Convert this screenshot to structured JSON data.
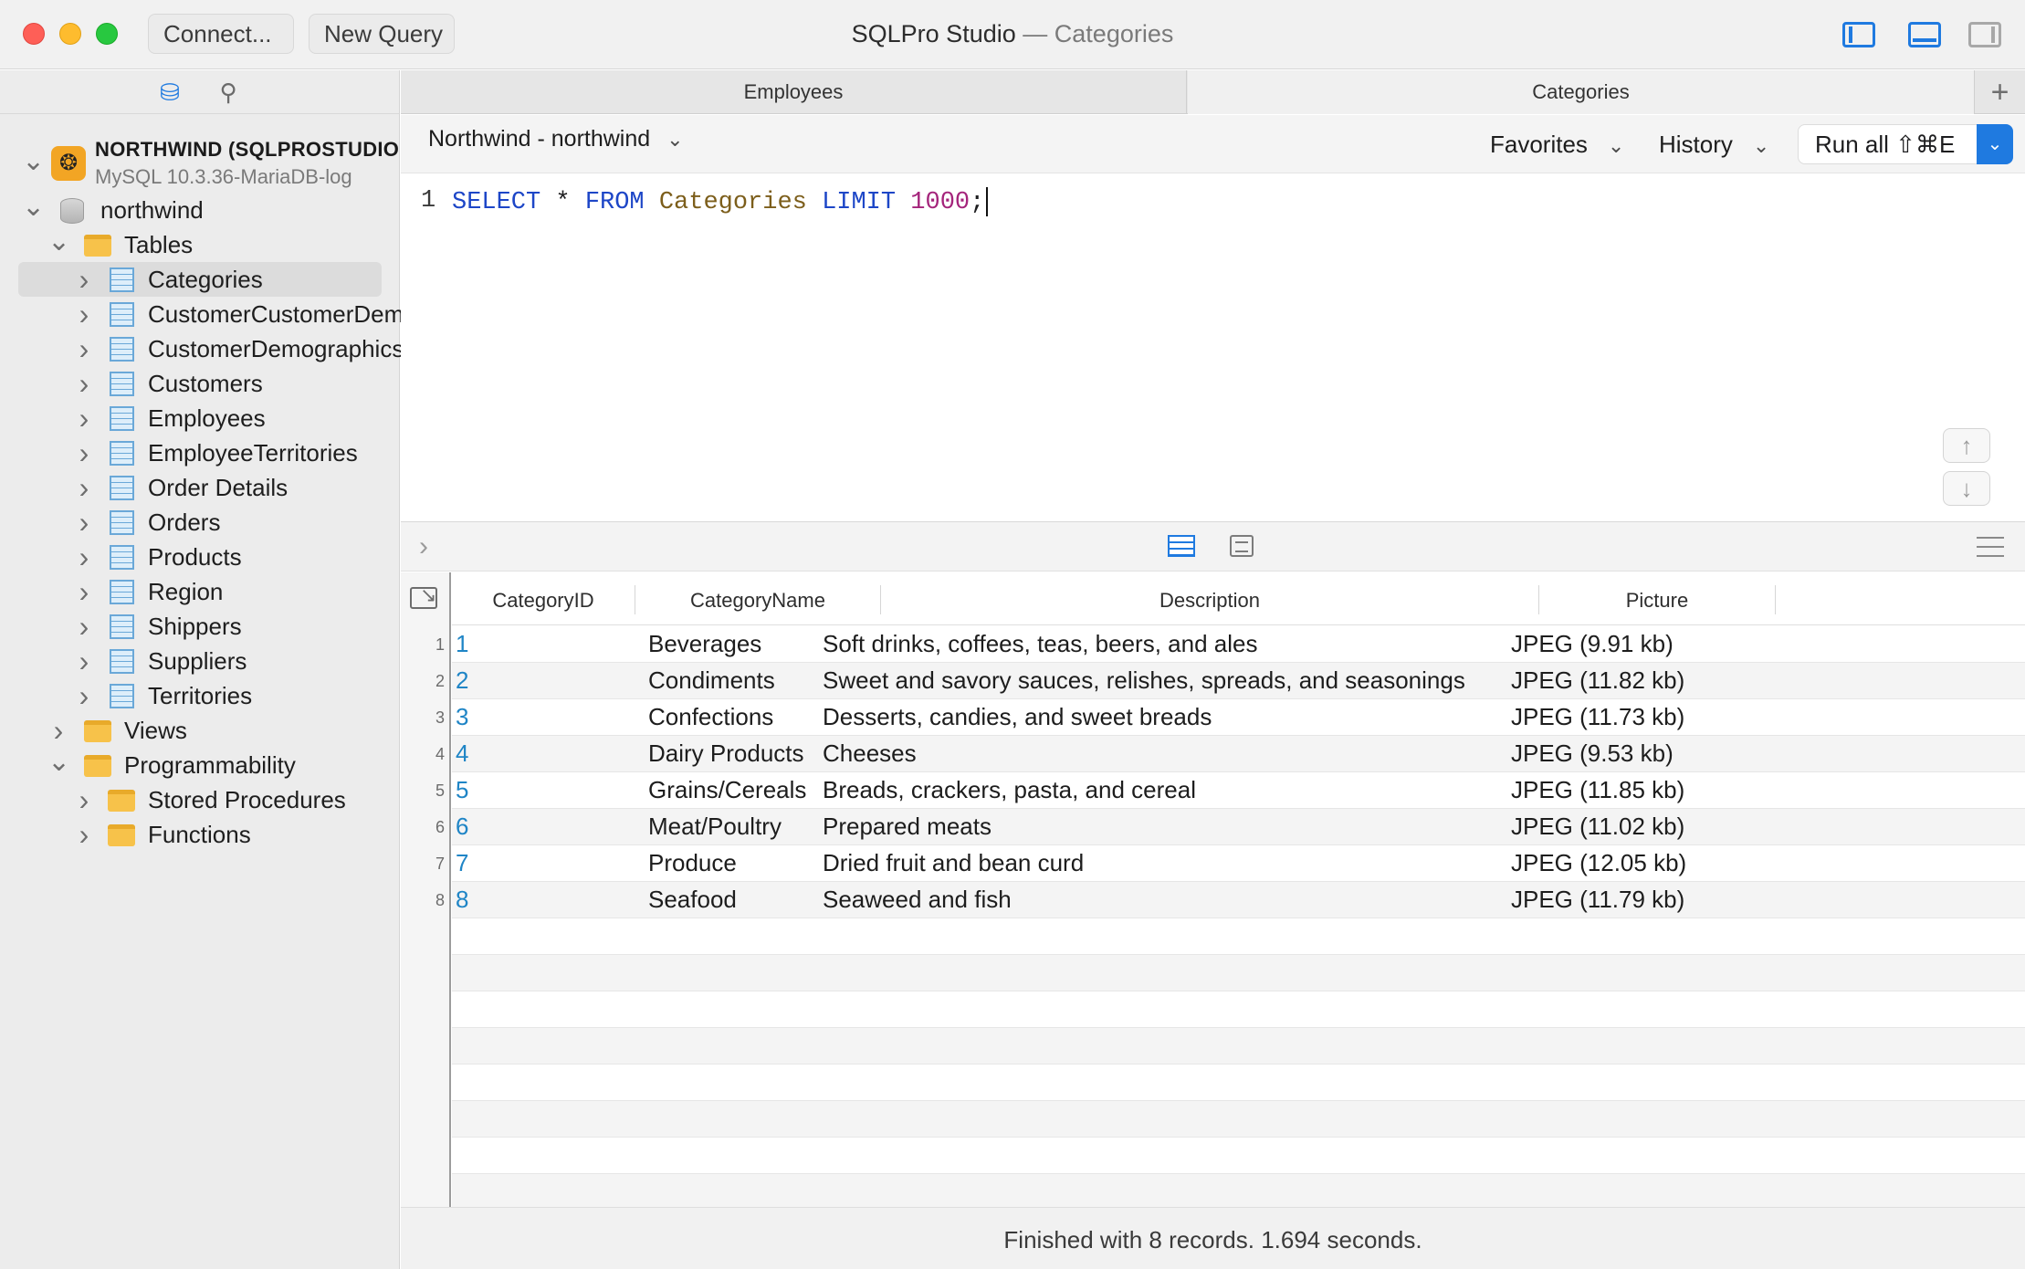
{
  "titlebar": {
    "connect_label": "Connect...",
    "new_query_label": "New Query",
    "app_title": "SQLPro Studio",
    "title_separator": "—",
    "document_title": "Categories",
    "accent_color": "#1f7ae0"
  },
  "sidebar": {
    "connection": {
      "name": "NORTHWIND (SQLPROSTUDIO",
      "version": "MySQL 10.3.36-MariaDB-log"
    },
    "database": "northwind",
    "tables_label": "Tables",
    "tables": [
      "Categories",
      "CustomerCustomerDemo",
      "CustomerDemographics",
      "Customers",
      "Employees",
      "EmployeeTerritories",
      "Order Details",
      "Orders",
      "Products",
      "Region",
      "Shippers",
      "Suppliers",
      "Territories"
    ],
    "selected_table": "Categories",
    "views_label": "Views",
    "programmability_label": "Programmability",
    "stored_procedures_label": "Stored Procedures",
    "functions_label": "Functions"
  },
  "tabs": [
    {
      "label": "Employees"
    },
    {
      "label": "Categories"
    }
  ],
  "query_toolbar": {
    "database_selector": "Northwind - northwind",
    "favorites_label": "Favorites",
    "history_label": "History",
    "run_all_label": "Run all ⇧⌘E"
  },
  "editor": {
    "line_number": "1",
    "tokens": {
      "select": "SELECT",
      "star": " * ",
      "from": "FROM",
      "table": "Categories",
      "limit": "LIMIT",
      "limit_value": "1000",
      "terminator": ";"
    }
  },
  "results": {
    "columns": [
      "CategoryID",
      "CategoryName",
      "Description",
      "Picture"
    ],
    "rows": [
      {
        "n": "1",
        "id": "1",
        "name": "Beverages",
        "desc": "Soft drinks, coffees, teas, beers, and ales",
        "pic": "JPEG (9.91 kb)"
      },
      {
        "n": "2",
        "id": "2",
        "name": "Condiments",
        "desc": "Sweet and savory sauces, relishes, spreads, and seasonings",
        "pic": "JPEG (11.82 kb)"
      },
      {
        "n": "3",
        "id": "3",
        "name": "Confections",
        "desc": "Desserts, candies, and sweet breads",
        "pic": "JPEG (11.73 kb)"
      },
      {
        "n": "4",
        "id": "4",
        "name": "Dairy Products",
        "desc": "Cheeses",
        "pic": "JPEG (9.53 kb)"
      },
      {
        "n": "5",
        "id": "5",
        "name": "Grains/Cereals",
        "desc": "Breads, crackers, pasta, and cereal",
        "pic": "JPEG (11.85 kb)"
      },
      {
        "n": "6",
        "id": "6",
        "name": "Meat/Poultry",
        "desc": "Prepared meats",
        "pic": "JPEG (11.02 kb)"
      },
      {
        "n": "7",
        "id": "7",
        "name": "Produce",
        "desc": "Dried fruit and bean curd",
        "pic": "JPEG (12.05 kb)"
      },
      {
        "n": "8",
        "id": "8",
        "name": "Seafood",
        "desc": "Seaweed and fish",
        "pic": "JPEG (11.79 kb)"
      }
    ]
  },
  "status": {
    "message": "Finished with 8 records. 1.694 seconds."
  }
}
